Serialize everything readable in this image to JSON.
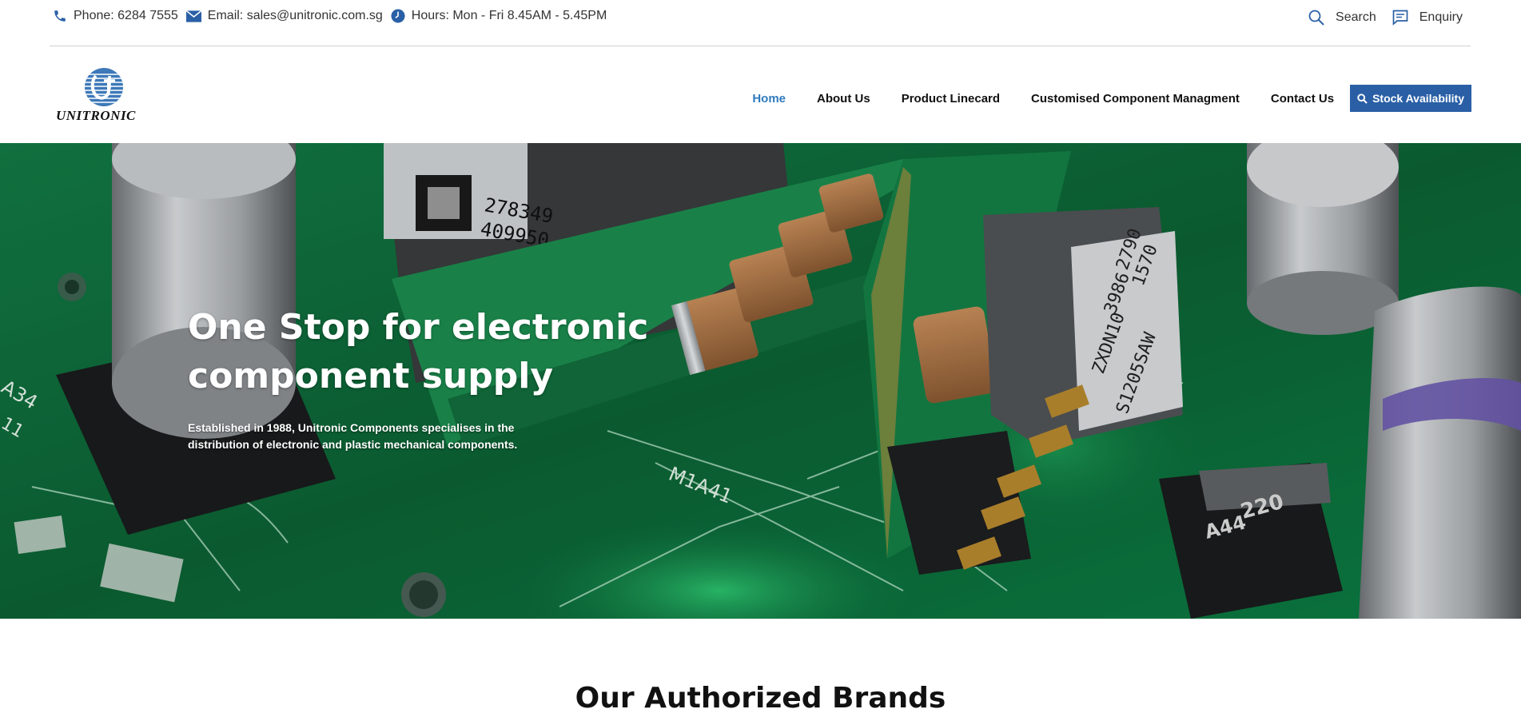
{
  "topbar": {
    "phone": "Phone: 6284 7555",
    "email": "Email: sales@unitronic.com.sg",
    "hours": "Hours: Mon - Fri 8.45AM - 5.45PM",
    "search_label": "Search",
    "enquiry_label": "Enquiry"
  },
  "header": {
    "logo_text": "UNITRONIC",
    "nav": [
      {
        "label": "Home",
        "active": true
      },
      {
        "label": "About Us"
      },
      {
        "label": "Product Linecard"
      },
      {
        "label": "Customised Component Managment"
      },
      {
        "label": "Contact Us"
      }
    ],
    "stock_button": "Stock Availability"
  },
  "hero": {
    "title": "One Stop for electronic component supply",
    "subtitle": "Established in 1988, Unitronic Components specialises in the distribution of electronic and plastic mechanical components.",
    "board_labels": [
      "278349",
      "409950",
      "2790",
      "1570",
      "3986",
      "ZXDN10",
      "S1205SAW",
      "M1A41",
      "220",
      "A44",
      "A34",
      "11"
    ]
  },
  "brands": {
    "title": "Our Authorized Brands"
  },
  "colors": {
    "accent": "#2f7bbd",
    "button": "#2a5fa6",
    "pcb_green": "#0f6a3c"
  }
}
